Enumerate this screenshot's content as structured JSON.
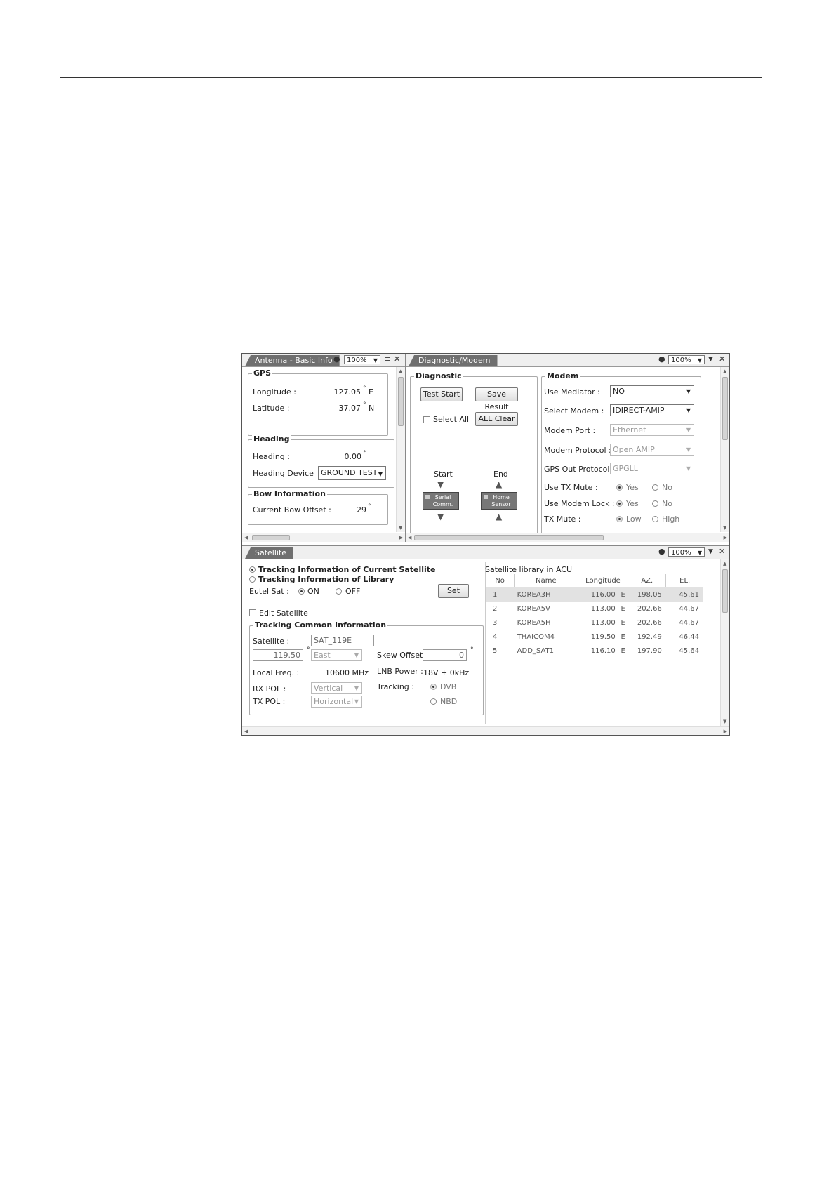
{
  "antenna_panel": {
    "tab_title": "Antenna - Basic Info",
    "zoom": "100%",
    "gps": {
      "legend": "GPS",
      "longitude_label": "Longitude :",
      "longitude_value": "127.05",
      "longitude_unit": "E",
      "latitude_label": "Latitude :",
      "latitude_value": "37.07",
      "latitude_unit": "N"
    },
    "heading": {
      "legend": "Heading",
      "heading_label": "Heading :",
      "heading_value": "0.00",
      "device_label": "Heading Device",
      "device_value": "GROUND TEST"
    },
    "bow": {
      "legend": "Bow Information",
      "offset_label": "Current Bow Offset :",
      "offset_value": "29"
    }
  },
  "diagnostic_panel": {
    "tab_title": "Diagnostic/Modem",
    "zoom": "100%",
    "diagnostic": {
      "legend": "Diagnostic",
      "test_start": "Test Start",
      "save_result": "Save Result",
      "select_all": "Select All",
      "all_clear": "ALL Clear",
      "start_label": "Start",
      "end_label": "End",
      "serial_comm": [
        "Serial",
        "Comm."
      ],
      "home_sensor": [
        "Home",
        "Sensor"
      ]
    },
    "modem": {
      "legend": "Modem",
      "use_mediator_label": "Use Mediator :",
      "use_mediator_value": "NO",
      "select_modem_label": "Select Modem :",
      "select_modem_value": "IDIRECT-AMIP",
      "modem_port_label": "Modem Port :",
      "modem_port_value": "Ethernet",
      "modem_protocol_label": "Modem Protocol :",
      "modem_protocol_value": "Open AMIP",
      "gps_out_label": "GPS Out Protocol :",
      "gps_out_value": "GPGLL",
      "use_tx_mute_label": "Use TX Mute :",
      "use_modem_lock_label": "Use Modem Lock :",
      "tx_mute_label": "TX Mute :",
      "yes": "Yes",
      "no": "No",
      "low": "Low",
      "high": "High"
    }
  },
  "satellite_panel": {
    "tab_title": "Satellite",
    "zoom": "100%",
    "radio_current": "Tracking Information of Current Satellite",
    "radio_library": "Tracking Information of Library",
    "eutel_label": "Eutel Sat :",
    "on": "ON",
    "off": "OFF",
    "set_button": "Set",
    "edit_satellite": "Edit Satellite",
    "tracking": {
      "legend": "Tracking Common  Information",
      "satellite_label": "Satellite :",
      "satellite_value": "SAT_119E",
      "longitude_value": "119.50",
      "direction_value": "East",
      "skew_label": "Skew Offset :",
      "skew_value": "0",
      "local_freq_label": "Local Freq. :",
      "local_freq_value": "10600 MHz",
      "lnb_label": "LNB Power :",
      "lnb_value": "18V + 0kHz",
      "rx_pol_label": "RX POL :",
      "rx_pol_value": "Vertical",
      "tx_pol_label": "TX POL :",
      "tx_pol_value": "Horizontal",
      "tracking_label": "Tracking :",
      "dvb": "DVB",
      "nbd": "NBD"
    },
    "library": {
      "title": "Satellite library in ACU",
      "columns": [
        "No",
        "Name",
        "Longitude",
        "AZ.",
        "EL."
      ],
      "rows": [
        {
          "no": "1",
          "name": "KOREA3H",
          "lon": "116.00",
          "dir": "E",
          "az": "198.05",
          "el": "45.61"
        },
        {
          "no": "2",
          "name": "KOREA5V",
          "lon": "113.00",
          "dir": "E",
          "az": "202.66",
          "el": "44.67"
        },
        {
          "no": "3",
          "name": "KOREA5H",
          "lon": "113.00",
          "dir": "E",
          "az": "202.66",
          "el": "44.67"
        },
        {
          "no": "4",
          "name": "THAICOM4",
          "lon": "119.50",
          "dir": "E",
          "az": "192.49",
          "el": "46.44"
        },
        {
          "no": "5",
          "name": "ADD_SAT1",
          "lon": "116.10",
          "dir": "E",
          "az": "197.90",
          "el": "45.64"
        }
      ]
    }
  }
}
